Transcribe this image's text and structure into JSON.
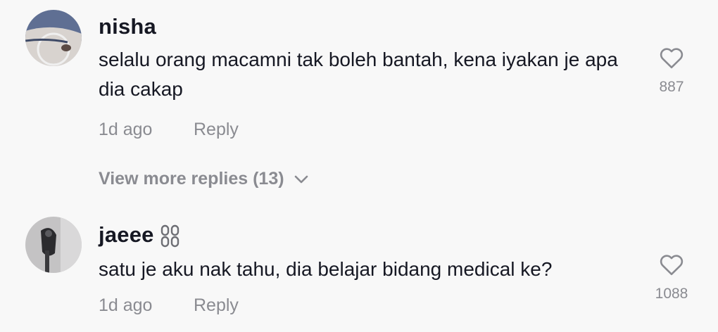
{
  "comments": [
    {
      "username": "nisha",
      "text": "selalu orang macamni tak boleh bantah, kena iyakan je apa dia cakap",
      "time": "1d ago",
      "reply_label": "Reply",
      "likes": "887",
      "icons": {
        "avatar": "avatar-photo",
        "like": "heart-outline-icon"
      }
    },
    {
      "username": "jaeee",
      "username_icon": "chain-link-icon",
      "text": "satu je aku nak tahu, dia belajar bidang medical ke?",
      "time": "1d ago",
      "reply_label": "Reply",
      "likes": "1088",
      "icons": {
        "avatar": "avatar-photo",
        "like": "heart-outline-icon"
      }
    }
  ],
  "view_more": {
    "label": "View more replies (13)",
    "icon": "chevron-down-icon"
  },
  "colors": {
    "background": "#f8f8f8",
    "primary_text": "#161823",
    "secondary_text": "#8a8b91"
  }
}
